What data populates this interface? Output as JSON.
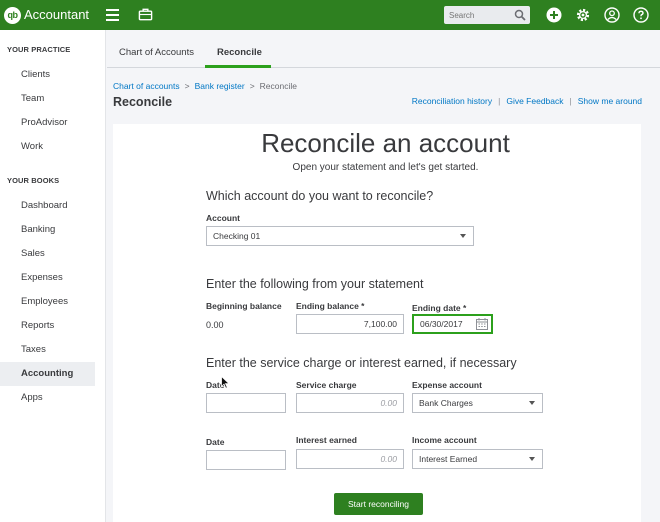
{
  "topbar": {
    "brand": "Accountant",
    "logo_text": "qb",
    "search_placeholder": "Search",
    "icons": [
      "menu-icon",
      "briefcase-icon",
      "search-icon",
      "plus-icon",
      "gear-icon",
      "user-icon",
      "help-icon"
    ],
    "color": "#2e8020"
  },
  "sidebar": {
    "practice_heading": "YOUR PRACTICE",
    "practice_items": [
      {
        "label": "Clients"
      },
      {
        "label": "Team"
      },
      {
        "label": "ProAdvisor"
      },
      {
        "label": "Work"
      }
    ],
    "books_heading": "YOUR BOOKS",
    "books_items": [
      {
        "label": "Dashboard"
      },
      {
        "label": "Banking"
      },
      {
        "label": "Sales"
      },
      {
        "label": "Expenses"
      },
      {
        "label": "Employees"
      },
      {
        "label": "Reports"
      },
      {
        "label": "Taxes"
      },
      {
        "label": "Accounting",
        "active": true
      },
      {
        "label": "Apps"
      }
    ]
  },
  "tabs": [
    {
      "label": "Chart of Accounts"
    },
    {
      "label": "Reconcile",
      "active": true
    }
  ],
  "breadcrumb": {
    "items": [
      "Chart of accounts",
      "Bank register",
      "Reconcile"
    ],
    "separator": ">"
  },
  "header": {
    "title": "Reconcile",
    "links": [
      "Reconciliation history",
      "Give Feedback",
      "Show me around"
    ]
  },
  "main": {
    "title": "Reconcile an account",
    "subtitle": "Open your statement and let's get started.",
    "account_section": {
      "heading": "Which account do you want to reconcile?",
      "account_label": "Account",
      "account_value": "Checking 01"
    },
    "statement_section": {
      "heading": "Enter the following from your statement",
      "beginning_balance_label": "Beginning balance",
      "beginning_balance_value": "0.00",
      "ending_balance_label": "Ending balance *",
      "ending_balance_value": "7,100.00",
      "ending_date_label": "Ending date *",
      "ending_date_value": "06/30/2017"
    },
    "service_section": {
      "heading": "Enter the service charge or interest earned, if necessary",
      "date_label": "Date",
      "service_charge_label": "Service charge",
      "service_charge_placeholder": "0.00",
      "expense_account_label": "Expense account",
      "expense_account_value": "Bank Charges",
      "date2_label": "Date",
      "interest_earned_label": "Interest earned",
      "interest_earned_placeholder": "0.00",
      "income_account_label": "Income account",
      "income_account_value": "Interest Earned"
    },
    "start_button": "Start reconciling"
  },
  "colors": {
    "brand_green": "#2e8020",
    "accent_green": "#2ca01c",
    "link_blue": "#0077c5"
  }
}
